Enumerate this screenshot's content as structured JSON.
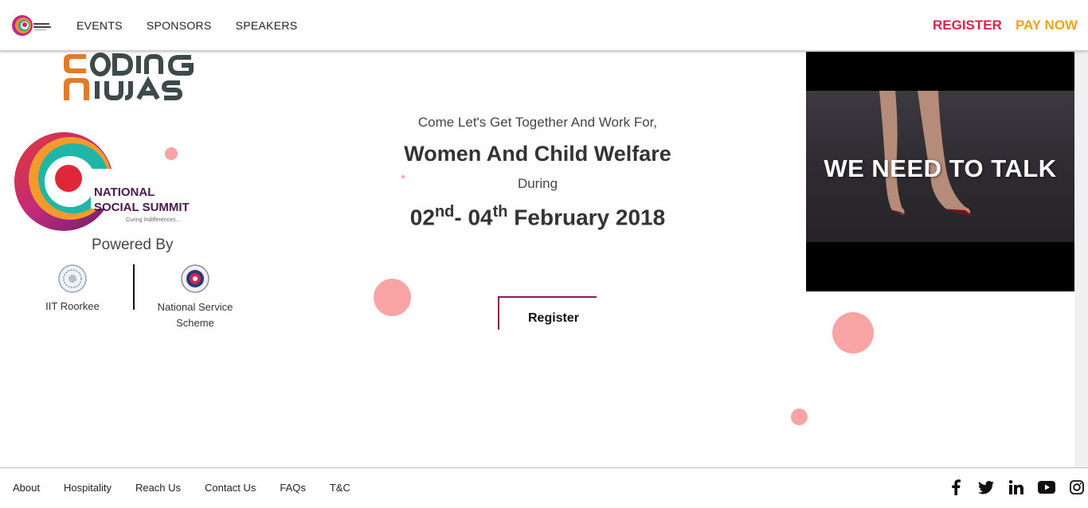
{
  "header": {
    "nav": [
      {
        "label": "EVENTS"
      },
      {
        "label": "SPONSORS"
      },
      {
        "label": "SPEAKERS"
      }
    ],
    "register_label": "REGISTER",
    "paynow_label": "PAY NOW",
    "logo_icon": "national-social-summit-logo"
  },
  "brand": {
    "name_line1": "NATIONAL",
    "name_line2": "SOCIAL SUMMIT",
    "slogan": "Curing Indifferences...",
    "sponsor_logo": "CODING NINJAS"
  },
  "powered": {
    "title": "Powered By",
    "partners": [
      {
        "name": "IIT Roorkee"
      },
      {
        "name": "National Service Scheme"
      }
    ]
  },
  "hero": {
    "tagline": "Come Let's Get Together And Work For,",
    "cause": "Women And Child Welfare",
    "during": "During",
    "date_start": "02",
    "date_start_suffix": "nd",
    "date_sep": "- ",
    "date_end": "04",
    "date_end_suffix": "th",
    "date_month_year": " February 2018",
    "register_button": "Register"
  },
  "video": {
    "title": "WE NEED TO TALK"
  },
  "footer": {
    "links": [
      {
        "label": "About"
      },
      {
        "label": "Hospitality"
      },
      {
        "label": "Reach Us"
      },
      {
        "label": "Contact Us"
      },
      {
        "label": "FAQs"
      },
      {
        "label": "T&C"
      }
    ],
    "socials": [
      "facebook-icon",
      "twitter-icon",
      "linkedin-icon",
      "youtube-icon",
      "instagram-icon"
    ]
  },
  "colors": {
    "accent_red": "#d8244a",
    "accent_orange": "#f0a21a",
    "dot_pink": "#f9a4a4"
  }
}
